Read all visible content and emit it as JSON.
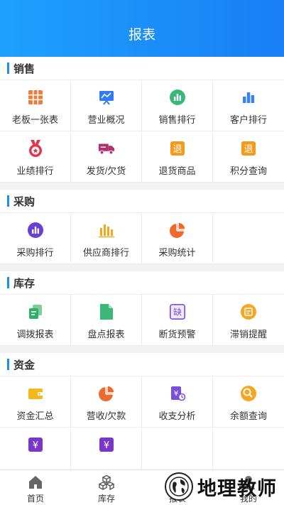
{
  "header": {
    "title": "报表"
  },
  "sections": {
    "sales": {
      "title": "销售",
      "items": [
        {
          "label": "老板一张表",
          "icon": "table-grid-icon"
        },
        {
          "label": "营业概况",
          "icon": "presentation-board-icon"
        },
        {
          "label": "销售排行",
          "icon": "bar-chart-circle-icon"
        },
        {
          "label": "客户排行",
          "icon": "bar-chart-icon"
        },
        {
          "label": "业绩排行",
          "icon": "medal-icon"
        },
        {
          "label": "发货/欠货",
          "icon": "delivery-truck-icon"
        },
        {
          "label": "退货商品",
          "icon": "return-goods-icon"
        },
        {
          "label": "积分查询",
          "icon": "points-query-icon"
        }
      ]
    },
    "purchase": {
      "title": "采购",
      "items": [
        {
          "label": "采购排行",
          "icon": "bar-chart-circle-icon"
        },
        {
          "label": "供应商排行",
          "icon": "bar-chart-icon"
        },
        {
          "label": "采购统计",
          "icon": "pie-chart-icon"
        }
      ]
    },
    "stock": {
      "title": "库存",
      "items": [
        {
          "label": "调拨报表",
          "icon": "transfer-docs-icon"
        },
        {
          "label": "盘点报表",
          "icon": "inventory-doc-icon"
        },
        {
          "label": "断货预警",
          "icon": "shortage-warning-icon"
        },
        {
          "label": "滞销提醒",
          "icon": "slow-sales-icon"
        }
      ]
    },
    "funds": {
      "title": "资金",
      "items": [
        {
          "label": "资金汇总",
          "icon": "wallet-icon"
        },
        {
          "label": "营收/欠款",
          "icon": "pie-chart-icon"
        },
        {
          "label": "收支分析",
          "icon": "finance-analysis-icon"
        },
        {
          "label": "余额查询",
          "icon": "balance-query-icon"
        },
        {
          "label": "",
          "icon": "yuan-icon"
        },
        {
          "label": "",
          "icon": "yuan-icon"
        }
      ]
    }
  },
  "icon_glyphs": {
    "return": "退",
    "shortage": "缺",
    "yuan": "¥"
  },
  "tabs": [
    {
      "label": "首页",
      "icon": "home-icon"
    },
    {
      "label": "库存",
      "icon": "cubes-icon"
    },
    {
      "label": "报表",
      "icon": "report-icon"
    },
    {
      "label": "我的",
      "icon": "user-icon"
    }
  ],
  "watermark": {
    "text": "地理教师"
  },
  "colors": {
    "header_start": "#1da1ff",
    "header_end": "#1a7ef5",
    "accent": "#1a8cf5"
  }
}
